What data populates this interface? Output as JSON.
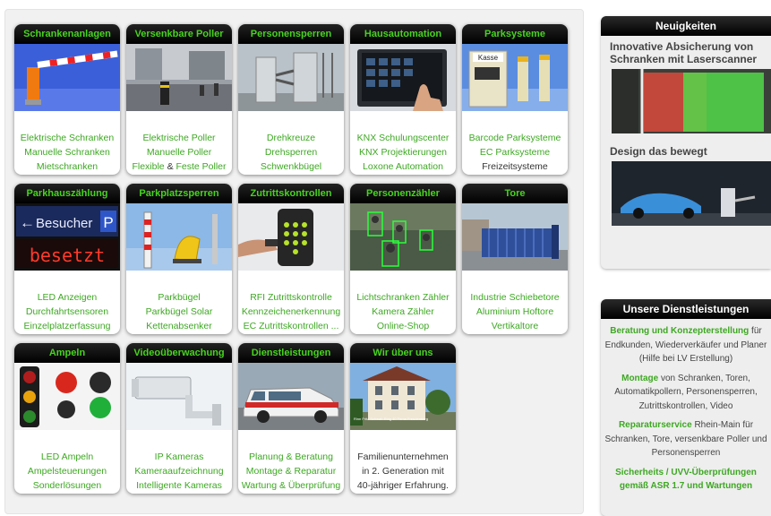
{
  "cards": [
    {
      "title": "Schrankenanlagen",
      "lines": [
        [
          "Elektrische Schranken"
        ],
        [
          "Manuelle Schranken"
        ],
        [
          "Mietschranken"
        ]
      ]
    },
    {
      "title": "Versenkbare Poller",
      "lines": [
        [
          "Elektrische Poller"
        ],
        [
          "Manuelle Poller"
        ],
        [
          "Flexible",
          " & ",
          "Feste Poller"
        ]
      ]
    },
    {
      "title": "Personensperren",
      "lines": [
        [
          "Drehkreuze"
        ],
        [
          "Drehsperren"
        ],
        [
          "Schwenkbügel"
        ]
      ]
    },
    {
      "title": "Hausautomation",
      "lines": [
        [
          "KNX Schulungscenter"
        ],
        [
          "KNX Projektierungen"
        ],
        [
          "Loxone Automation"
        ]
      ]
    },
    {
      "title": "Parksysteme",
      "lines": [
        [
          "Barcode Parksysteme"
        ],
        [
          "EC Parksysteme"
        ],
        [
          "Freizeitsysteme"
        ]
      ]
    },
    {
      "title": "Parkhauszählung",
      "lines": [
        [
          "LED Anzeigen"
        ],
        [
          "Durchfahrtsensoren"
        ],
        [
          "Einzelplatzerfassung"
        ]
      ]
    },
    {
      "title": "Parkplatzsperren",
      "lines": [
        [
          "Parkbügel"
        ],
        [
          "Parkbügel Solar"
        ],
        [
          "Kettenabsenker"
        ]
      ]
    },
    {
      "title": "Zutrittskontrollen",
      "lines": [
        [
          "RFI Zutrittskontrolle"
        ],
        [
          "Kennzeichenerkennung"
        ],
        [
          "EC Zutrittskontrollen ..."
        ]
      ]
    },
    {
      "title": "Personenzähler",
      "lines": [
        [
          "Lichtschranken Zähler"
        ],
        [
          "Kamera Zähler"
        ],
        [
          "Online-Shop"
        ]
      ]
    },
    {
      "title": "Tore",
      "lines": [
        [
          "Industrie Schiebetore"
        ],
        [
          "Aluminium Hoftore"
        ],
        [
          "Vertikaltore"
        ]
      ]
    },
    {
      "title": "Ampeln",
      "lines": [
        [
          "LED Ampeln"
        ],
        [
          "Ampelsteuerungen"
        ],
        [
          "Sonderlösungen"
        ]
      ]
    },
    {
      "title": "Videoüberwachung",
      "lines": [
        [
          "IP Kameras"
        ],
        [
          "Kameraaufzeichnung"
        ],
        [
          "Intelligente Kameras"
        ]
      ]
    },
    {
      "title": "Dienstleistungen",
      "lines": [
        [
          "Planung & Beratung"
        ],
        [
          "Montage & Reparatur"
        ],
        [
          "Wartung & Überprüfung"
        ]
      ]
    },
    {
      "title": "Wir über uns",
      "lines": [
        [
          "Familienunternehmen"
        ],
        [
          "in 2. Generation mit"
        ],
        [
          "40-jähriger Erfahrung."
        ]
      ]
    }
  ],
  "news": {
    "heading": "Neuigkeiten",
    "items": [
      {
        "title": "Innovative Absicherung von Schranken mit Laserscanner"
      },
      {
        "title": "Design das bewegt"
      }
    ]
  },
  "services": {
    "heading": "Unsere Dienstleistungen",
    "blocks": [
      {
        "strong": "Beratung und Konzepterstellung",
        "rest": " für Endkunden, Wiederverkäufer und Planer (Hilfe bei LV Erstellung)"
      },
      {
        "strong": "Montage",
        "rest": " von Schranken, Toren, Automatikpollern, Personensperren, Zutrittskontrollen, Video"
      },
      {
        "strong": "Reparaturservice",
        "rest": " Rhein-Main für Schranken, Tore, versenkbare Poller und Personensperren"
      },
      {
        "strong": "Sicherheits / UVV-Überprüfungen gemäß ASR 1.7 und Wartungen",
        "rest": ""
      }
    ]
  },
  "image_text": {
    "besucher": "Besucher",
    "p": "P",
    "besetzt": "besetzt",
    "kasse": "Kasse",
    "house_caption": "Rinn\nFritz Schwab-Ring 40\nFirma Freudenberg"
  }
}
